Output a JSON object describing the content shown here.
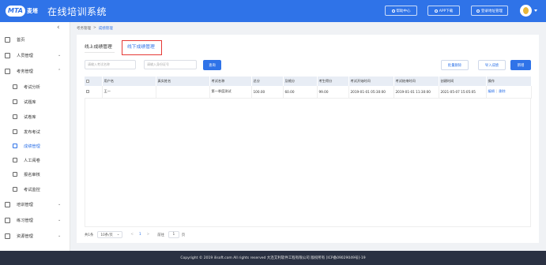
{
  "header": {
    "logo_mark": "MTA",
    "logo_cn": "麦塔",
    "title": "在线培训系统",
    "buttons": [
      {
        "label": "帮助中心",
        "icon": "help-icon"
      },
      {
        "label": "APP下载",
        "icon": "download-icon"
      },
      {
        "label": "登录地址管理",
        "icon": "location-icon"
      }
    ]
  },
  "sidebar": {
    "items": [
      {
        "label": "首页",
        "icon": "home-icon"
      },
      {
        "label": "人员管理",
        "icon": "user-icon"
      },
      {
        "label": "考务管理",
        "icon": "exam-icon"
      },
      {
        "label": "考试分析",
        "icon": "analysis-icon"
      },
      {
        "label": "试题库",
        "icon": "question-bank-icon"
      },
      {
        "label": "试卷库",
        "icon": "paper-bank-icon"
      },
      {
        "label": "发布考试",
        "icon": "publish-icon"
      },
      {
        "label": "成绩管理",
        "icon": "score-icon"
      },
      {
        "label": "人工阅卷",
        "icon": "grading-icon"
      },
      {
        "label": "报名审核",
        "icon": "audit-icon"
      },
      {
        "label": "考试监控",
        "icon": "monitor-icon"
      },
      {
        "label": "培训管理",
        "icon": "training-icon"
      },
      {
        "label": "练习管理",
        "icon": "practice-icon"
      },
      {
        "label": "资源管理",
        "icon": "resource-icon"
      }
    ]
  },
  "breadcrumb": {
    "parent": "考务管理",
    "separator": ">",
    "current": "成绩管理"
  },
  "tabs": {
    "online": "线上成绩管理",
    "offline": "线下成绩管理"
  },
  "filters": {
    "exam_name_placeholder": "请输入考试名称",
    "id_placeholder": "请输入身份证号",
    "search_label": "查询"
  },
  "actions": {
    "batch_delete": "批量删除",
    "import": "导入成绩",
    "add": "新增"
  },
  "table": {
    "headers": [
      "",
      "用户名",
      "真实姓名",
      "考试名称",
      "总分",
      "及格分",
      "考生得分",
      "考试开始时间",
      "考试结束时间",
      "创建时间",
      "操作"
    ],
    "rows": [
      {
        "username": "王一",
        "real_name": "",
        "exam": "第一季度测试",
        "total": "100.00",
        "pass": "60.00",
        "score": "99.00",
        "start": "2019-01-01 05:30:00",
        "end": "2019-01-01 11:30:00",
        "created": "2021-05-07 15:05:05",
        "edit": "编辑",
        "delete": "删除"
      }
    ]
  },
  "pagination": {
    "total": "共1条",
    "page_size": "10条/页",
    "prev": "<",
    "current": "1",
    "next": ">",
    "goto_label": "前往",
    "goto_value": "1",
    "page_unit": "页"
  },
  "footer": {
    "text": "Copyright © 2019 ilisoft.com All rights reserved 大连艾利软件工程有限公司 版权所有 [ICP备09029049号]-19"
  },
  "colors": {
    "primary": "#2f73e8",
    "highlight_box": "#e53935",
    "footer_bg": "#2a3142"
  }
}
